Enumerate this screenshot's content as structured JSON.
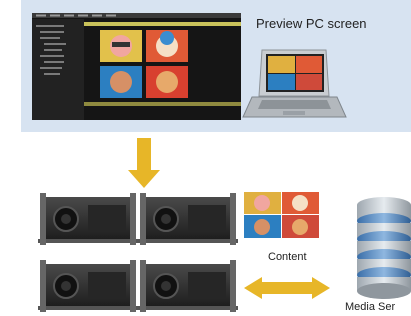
{
  "preview": {
    "label": "Preview PC screen",
    "software_menu": [
      "File",
      "Edit",
      "View",
      "Tools",
      "Window",
      "Help"
    ]
  },
  "content": {
    "label": "Content"
  },
  "server": {
    "label": "Media Ser"
  },
  "colors": {
    "panel_bg": "#d7e3f1",
    "arrow": "#e7b628",
    "software_bg": "#151515",
    "software_accent": "#c9c25a",
    "projector_body": "#2a2a2a",
    "server_silver": "#c4ccd3",
    "server_blue": "#5b8fc7"
  },
  "icons": [
    "projector-icon",
    "laptop-icon",
    "database-server-icon",
    "content-thumbnail-icon"
  ]
}
